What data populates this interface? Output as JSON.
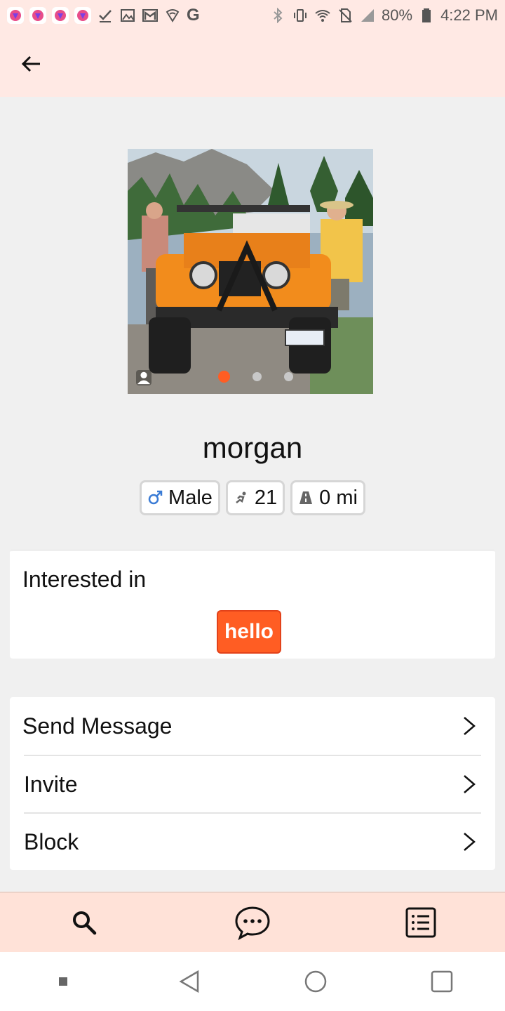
{
  "status_bar": {
    "battery_percent": "80%",
    "time": "4:22 PM",
    "google_glyph": "G",
    "notification_icons": [
      "app-notification-icon",
      "app-notification-icon",
      "app-notification-icon",
      "app-notification-icon",
      "check-icon",
      "image-icon",
      "gmail-icon",
      "vpn-shield-icon",
      "google-icon"
    ],
    "system_icons": [
      "bluetooth-icon",
      "vibrate-icon",
      "wifi-icon",
      "no-sim-icon",
      "signal-icon",
      "battery-icon"
    ]
  },
  "app_bar": {
    "back_icon": "arrow-left-icon"
  },
  "profile": {
    "name": "morgan",
    "photo_count": 3,
    "active_photo_index": 0,
    "tags": {
      "gender": {
        "icon": "male-symbol-icon",
        "label": "Male"
      },
      "age": {
        "icon": "running-person-icon",
        "label": "21"
      },
      "distance": {
        "icon": "road-icon",
        "label": "0 mi"
      }
    }
  },
  "interests": {
    "title": "Interested in",
    "chip": "hello"
  },
  "actions": [
    {
      "label": "Send Message",
      "icon": "chevron-right-icon"
    },
    {
      "label": "Invite",
      "icon": "chevron-right-icon"
    },
    {
      "label": "Block",
      "icon": "chevron-right-icon"
    }
  ],
  "bottom_nav": {
    "items": [
      {
        "icon": "search-icon"
      },
      {
        "icon": "chat-bubble-icon"
      },
      {
        "icon": "list-icon"
      }
    ]
  },
  "system_nav": {
    "items": [
      "square-dot-icon",
      "back-triangle-icon",
      "home-circle-icon",
      "recents-square-icon"
    ]
  },
  "colors": {
    "accent": "#ff5d23",
    "header_bg": "#ffe9e4",
    "bottom_nav_bg": "#ffe2d8",
    "page_bg": "#f0f0f0"
  }
}
